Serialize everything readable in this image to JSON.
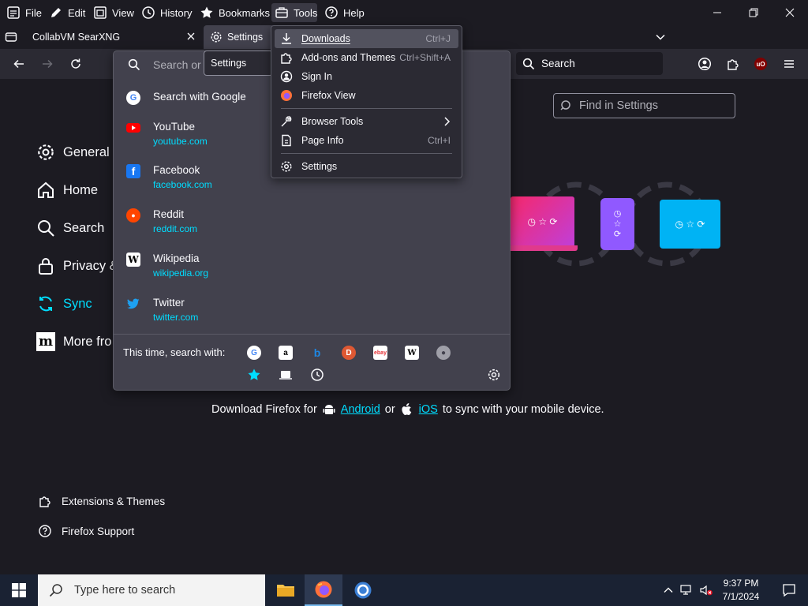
{
  "menubar": {
    "items": [
      "File",
      "Edit",
      "View",
      "History",
      "Bookmarks",
      "Tools",
      "Help"
    ]
  },
  "tabs": [
    {
      "label": "CollabVM SearXNG"
    },
    {
      "label": "Settings"
    }
  ],
  "navbar": {
    "search_placeholder": "Search",
    "extension_badge": "uO"
  },
  "url_panel": {
    "input_placeholder": "Search or e",
    "settings_tooltip": "Settings",
    "suggestions": [
      {
        "title": "Search with Google",
        "url": "",
        "icon": "google-icon"
      },
      {
        "title": "YouTube",
        "url": "youtube.com",
        "icon": "youtube-icon"
      },
      {
        "title": "Facebook",
        "url": "facebook.com",
        "icon": "facebook-icon"
      },
      {
        "title": "Reddit",
        "url": "reddit.com",
        "icon": "reddit-icon"
      },
      {
        "title": "Wikipedia",
        "url": "wikipedia.org",
        "icon": "wikipedia-icon"
      },
      {
        "title": "Twitter",
        "url": "twitter.com",
        "icon": "twitter-icon"
      }
    ],
    "one_off_label": "This time, search with:",
    "engines": [
      "google",
      "amazon",
      "bing",
      "duckduckgo",
      "ebay",
      "wikipedia",
      "searxng",
      "bookmarks",
      "tabs",
      "history"
    ]
  },
  "tools_menu": {
    "items": [
      {
        "label": "Downloads",
        "shortcut": "Ctrl+J",
        "icon": "download-icon",
        "highlighted": true
      },
      {
        "label": "Add-ons and Themes",
        "shortcut": "Ctrl+Shift+A",
        "icon": "puzzle-icon"
      },
      {
        "label": "Sign In",
        "shortcut": "",
        "icon": "account-icon"
      },
      {
        "label": "Firefox View",
        "shortcut": "",
        "icon": "firefox-view-icon"
      },
      {
        "label": "Browser Tools",
        "shortcut": "",
        "icon": "wrench-icon",
        "submenu": true
      },
      {
        "label": "Page Info",
        "shortcut": "Ctrl+I",
        "icon": "page-info-icon"
      },
      {
        "label": "Settings",
        "shortcut": "",
        "icon": "gear-icon"
      }
    ]
  },
  "settings": {
    "categories": [
      {
        "label": "General",
        "icon": "gear-icon"
      },
      {
        "label": "Home",
        "icon": "home-icon"
      },
      {
        "label": "Search",
        "icon": "search-icon"
      },
      {
        "label": "Privacy &",
        "icon": "lock-icon"
      },
      {
        "label": "Sync",
        "icon": "sync-icon",
        "active": true
      },
      {
        "label": "More fro",
        "icon": "mozilla-icon"
      }
    ],
    "find_placeholder": "Find in Settings",
    "sync_text": {
      "prefix": "Download Firefox for",
      "android": "Android",
      "or": "or",
      "ios": "iOS",
      "suffix": "to sync with your mobile device."
    },
    "footer": [
      {
        "label": "Extensions & Themes",
        "icon": "puzzle-icon"
      },
      {
        "label": "Firefox Support",
        "icon": "help-icon"
      }
    ]
  },
  "taskbar": {
    "search_placeholder": "Type here to search",
    "time": "9:37 PM",
    "date": "7/1/2024"
  },
  "colors": {
    "accent": "#00ddff",
    "menu_bg": "#2b2a33",
    "panel_bg": "#42414d",
    "page_bg": "#1c1b22"
  }
}
